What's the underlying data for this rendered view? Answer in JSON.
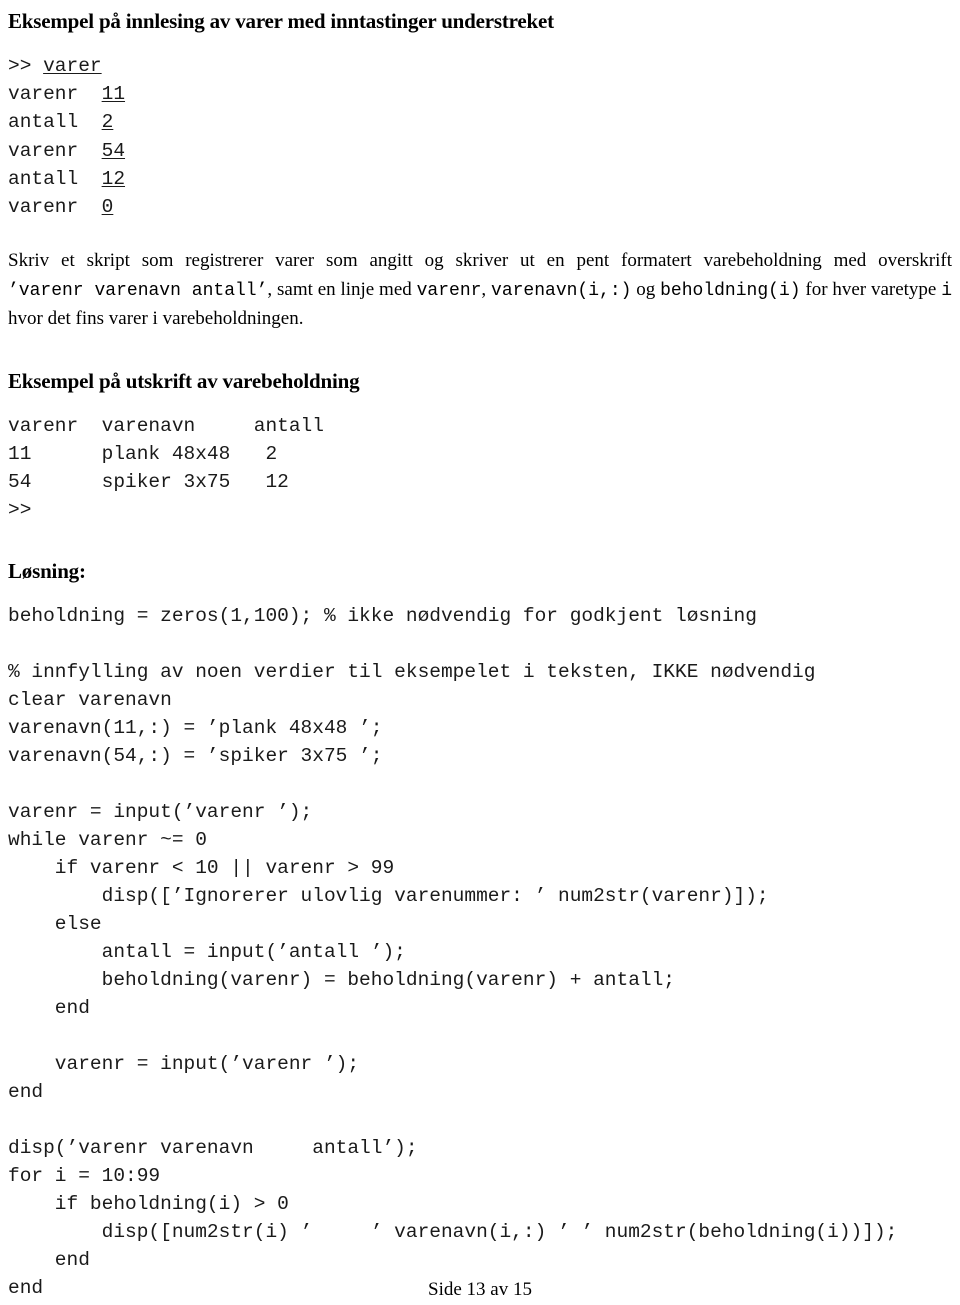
{
  "document": {
    "footer_text": "Side 13 av 15"
  },
  "sections": {
    "heading_input_example": "Eksempel på innlesing av varer med inntastinger understreket",
    "heading_output_example": "Eksempel på utskrift av varebeholdning",
    "heading_solution": "Løsning:"
  },
  "terminal_session": {
    "lines": [
      {
        "prompt": ">> ",
        "label": "",
        "value": "varer",
        "underlined": true
      },
      {
        "prompt": "",
        "label": "varenr  ",
        "value": "11",
        "underlined": true
      },
      {
        "prompt": "",
        "label": "antall  ",
        "value": "2",
        "underlined": true
      },
      {
        "prompt": "",
        "label": "varenr  ",
        "value": "54",
        "underlined": true
      },
      {
        "prompt": "",
        "label": "antall  ",
        "value": "12",
        "underlined": true
      },
      {
        "prompt": "",
        "label": "varenr  ",
        "value": "0",
        "underlined": true
      }
    ]
  },
  "task_paragraph": {
    "part1": "Skriv et skript som registrerer varer som angitt og skriver ut en pent formatert varebeholdning med overskrift ",
    "code1": "’varenr varenavn antall’",
    "part2": ", samt en linje med ",
    "code2": "varenr",
    "part3": ", ",
    "code3": "varenavn(i,:)",
    "part4": " og ",
    "code4": "beholdning(i)",
    "part5": " for hver varetype ",
    "code5": "i",
    "part6": " hvor det fins varer i varebeholdningen."
  },
  "output_example": {
    "text": "varenr  varenavn     antall\n11      plank 48x48   2\n54      spiker 3x75   12\n>>"
  },
  "solution_code": {
    "text": "beholdning = zeros(1,100); % ikke nødvendig for godkjent løsning\n\n% innfylling av noen verdier til eksempelet i teksten, IKKE nødvendig\nclear varenavn\nvarenavn(11,:) = ’plank 48x48 ’;\nvarenavn(54,:) = ’spiker 3x75 ’;\n\nvarenr = input(’varenr ’);\nwhile varenr ~= 0\n    if varenr < 10 || varenr > 99\n        disp([’Ignorerer ulovlig varenummer: ’ num2str(varenr)]);\n    else\n        antall = input(’antall ’);\n        beholdning(varenr) = beholdning(varenr) + antall;\n    end\n\n    varenr = input(’varenr ’);\nend\n\ndisp(’varenr varenavn     antall’);\nfor i = 10:99\n    if beholdning(i) > 0\n        disp([num2str(i) ’     ’ varenavn(i,:) ’ ’ num2str(beholdning(i))]);\n    end\nend"
  }
}
